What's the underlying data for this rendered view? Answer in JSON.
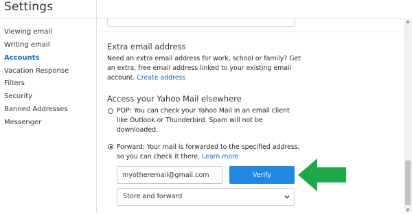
{
  "header": {
    "title": "Settings"
  },
  "sidebar": {
    "items": [
      {
        "label": "Viewing email"
      },
      {
        "label": "Writing email"
      },
      {
        "label": "Accounts"
      },
      {
        "label": "Vacation Response"
      },
      {
        "label": "Filters"
      },
      {
        "label": "Security"
      },
      {
        "label": "Banned Addresses"
      },
      {
        "label": "Messenger"
      }
    ]
  },
  "extra_email": {
    "heading": "Extra email address",
    "description": "Need an extra email address for work, school or family? Get an extra, free email address linked to your existing email account.",
    "link": "Create address"
  },
  "access": {
    "heading": "Access your Yahoo Mail elsewhere",
    "pop_label": "POP: You can check your Yahoo Mail in an email client like Outlook or Thunderbird. Spam will not be downloaded.",
    "forward_label": "Forward: Your mail is forwarded to the specified address, so you can check it there.",
    "learn_more": "Learn more",
    "email_value": "myotheremail@gmail.com",
    "verify_label": "Verify",
    "forward_mode": "Store and forward"
  },
  "colors": {
    "link": "#1a68c9",
    "verify_button": "#1e88e5",
    "annotation_arrow": "#1ea84a"
  }
}
